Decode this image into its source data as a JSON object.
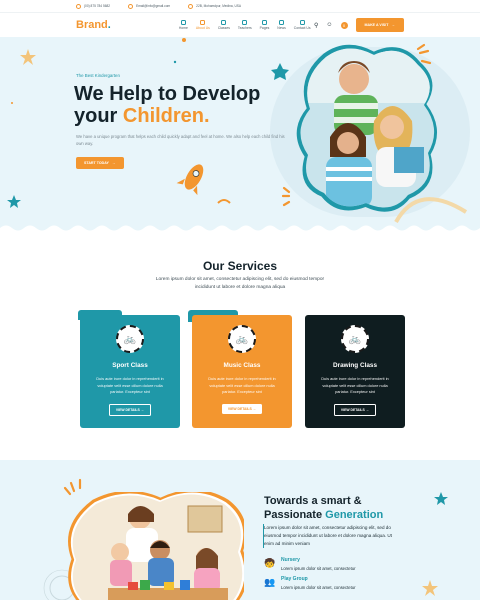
{
  "topbar": {
    "phone": "(00) 875 784 5682",
    "email": "Email@info@gmail.com",
    "address": "22B, Mohamdpur, Medina, USA"
  },
  "nav": {
    "brand": "Brand",
    "brand_dot": ".",
    "menu": [
      "Home",
      "About Us",
      "Classes",
      "Teachers",
      "Pages",
      "News",
      "Contact Us"
    ],
    "active_index": 1,
    "cart_count": "0",
    "cta": "MAKE A VISIT"
  },
  "hero": {
    "tag": "The Best Kindergarten",
    "title_line1": "We Help to Develop",
    "title_line2_prefix": "your ",
    "title_line2_highlight": "Children.",
    "description": "We have a unique program that helps each child quickly adapt and feel at home. We also help each child find his own way.",
    "button": "START TODAY"
  },
  "services": {
    "title": "Our Services",
    "subtitle": "Lorem ipsum dolor sit amet, consectetur adipiscing elit, sed do eiusmod tempor incididunt ut labore et dolore magna aliqua",
    "cards": [
      {
        "title": "Sport Class",
        "desc": "Duis aute irure dolor in reprehenderit in voluptate velit esse cillum dolore nulla pariatur. Excepteur sint",
        "button": "VIEW DETAILS"
      },
      {
        "title": "Music Class",
        "desc": "Duis aute irure dolor in reprehenderit in voluptate velit esse cillum dolore nulla pariatur. Excepteur sint",
        "button": "VIEW DETAILS"
      },
      {
        "title": "Drawing Class",
        "desc": "Duis aute irure dolor in reprehenderit in voluptate velit esse cillum dolore nulla pariatur. Excepteur sint",
        "button": "VIEW DETAILS"
      }
    ]
  },
  "about": {
    "title_line1": "Towards a smart &",
    "title_line2_prefix": "Passionate ",
    "title_line2_highlight": "Generation",
    "description": "Lorem ipsum dolor sit amet, consectetur adipiscing elit, sed do eiusmod tempor incididunt ut labore et dolore magna aliqua. Ut enim ad minim veniam",
    "features": [
      {
        "title": "Nursery",
        "desc": "Lorem ipsum dolor sit amet, consectetur"
      },
      {
        "title": "Play Group",
        "desc": "Lorem ipsum dolor sit amet, consectetur"
      }
    ]
  },
  "colors": {
    "accent_orange": "#f3962f",
    "accent_teal": "#1f98a8",
    "dark": "#0f1d20",
    "light_bg": "#e8f5fa"
  },
  "icons": [
    "phone-icon",
    "mail-icon",
    "location-icon",
    "search-icon",
    "user-icon",
    "cart-icon",
    "star-icon",
    "rocket-icon",
    "bicycle-icon",
    "nursery-icon",
    "playgroup-icon"
  ]
}
